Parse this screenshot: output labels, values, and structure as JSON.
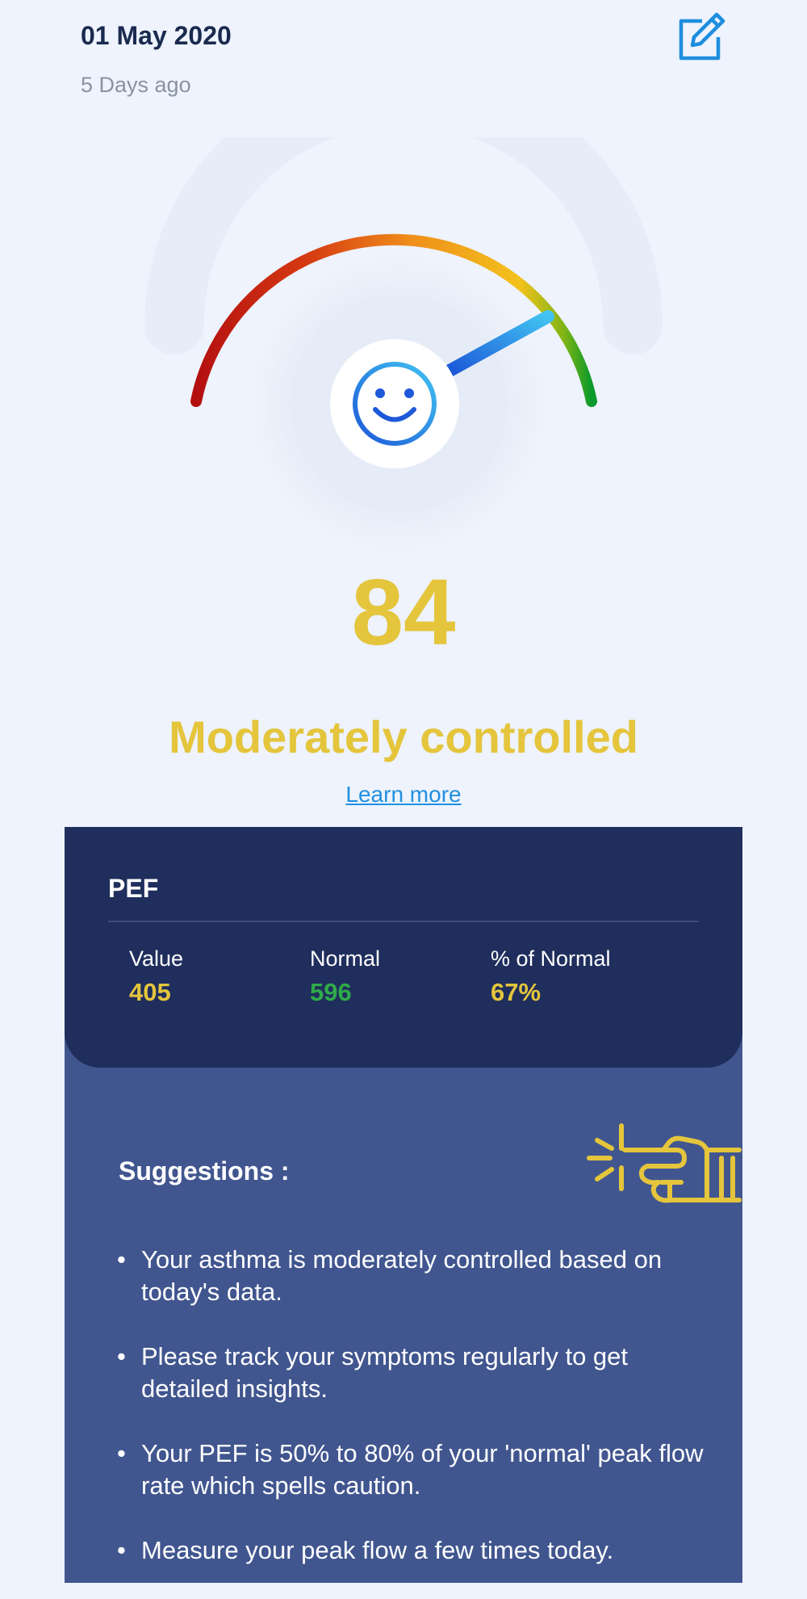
{
  "header": {
    "date": "01 May 2020",
    "ago": "5 Days ago"
  },
  "score": {
    "value": "84",
    "status": "Moderately controlled",
    "learn_more": "Learn more",
    "level": 0.84
  },
  "pef": {
    "title": "PEF",
    "stats": [
      {
        "label": "Value",
        "value": "405"
      },
      {
        "label": "Normal",
        "value": "596"
      },
      {
        "label": "% of Normal",
        "value": "67%"
      }
    ]
  },
  "suggestions": {
    "title": "Suggestions :",
    "items": [
      "Your asthma is moderately controlled based on today's data.",
      "Please track your symptoms regularly to get detailed insights.",
      "Your PEF is 50% to 80% of your 'normal' peak flow rate which spells caution.",
      "Measure your peak flow a few times today."
    ]
  },
  "icons": {
    "edit": "edit-icon",
    "face": "smiley-face-icon",
    "hand": "pointing-hand-icon"
  },
  "colors": {
    "accent": "#e4c53c",
    "normal_green": "#2fab4a",
    "link": "#2190e0",
    "dark_card": "#1f2e5c",
    "light_card": "#41568f"
  }
}
